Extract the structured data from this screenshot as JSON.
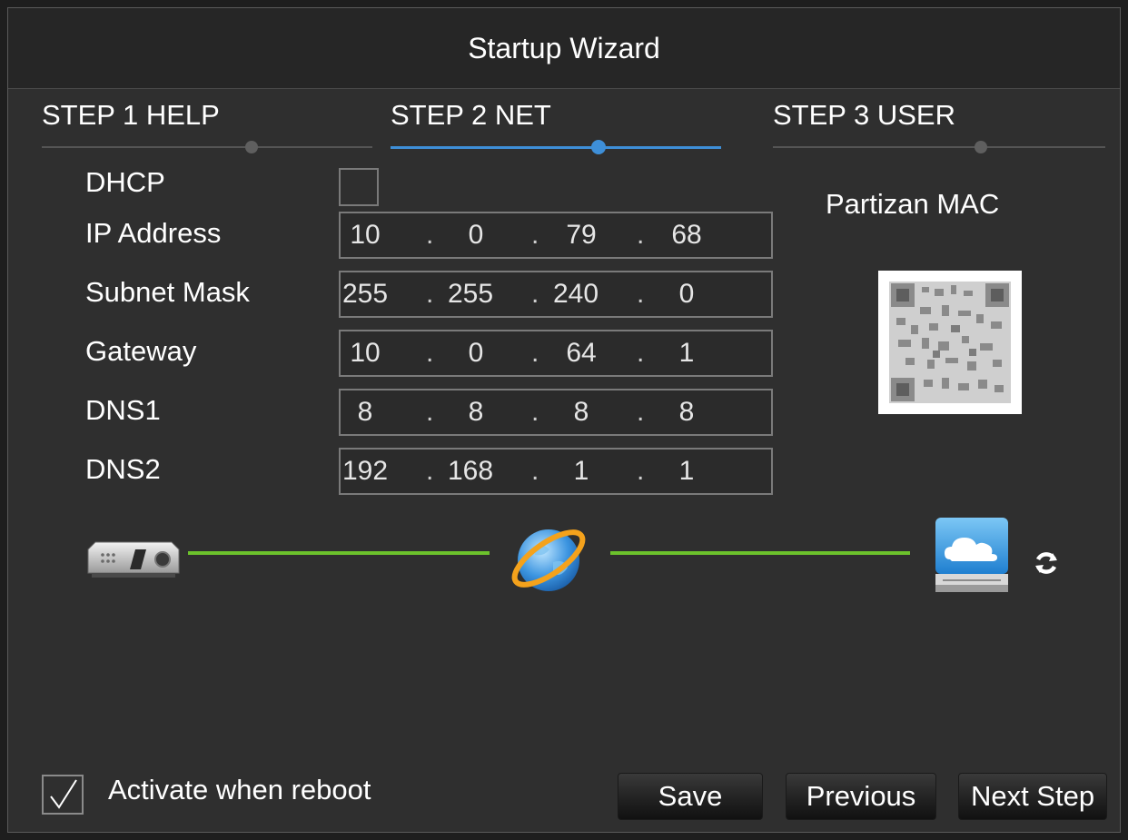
{
  "title": "Startup Wizard",
  "steps": [
    {
      "label": "STEP 1 HELP",
      "active": false
    },
    {
      "label": "STEP 2 NET",
      "active": true
    },
    {
      "label": "STEP 3 USER",
      "active": false
    }
  ],
  "network": {
    "dhcp_label": "DHCP",
    "dhcp_checked": false,
    "ip_label": "IP Address",
    "ip": [
      "10",
      "0",
      "79",
      "68"
    ],
    "subnet_label": "Subnet Mask",
    "subnet": [
      "255",
      "255",
      "240",
      "0"
    ],
    "gateway_label": "Gateway",
    "gateway": [
      "10",
      "0",
      "64",
      "1"
    ],
    "dns1_label": "DNS1",
    "dns1": [
      "8",
      "8",
      "8",
      "8"
    ],
    "dns2_label": "DNS2",
    "dns2": [
      "192",
      "168",
      "1",
      "1"
    ]
  },
  "mac_label": "Partizan MAC",
  "connection": {
    "icons": [
      "dvr-device-icon",
      "internet-globe-icon",
      "cloud-server-icon",
      "refresh-icon"
    ],
    "link_color": "#6cc22c"
  },
  "footer": {
    "activate_label": "Activate when reboot",
    "activate_checked": true,
    "save_label": "Save",
    "previous_label": "Previous",
    "next_label": "Next Step"
  },
  "colors": {
    "accent": "#3e8fd8",
    "background": "#2f2f2f"
  }
}
